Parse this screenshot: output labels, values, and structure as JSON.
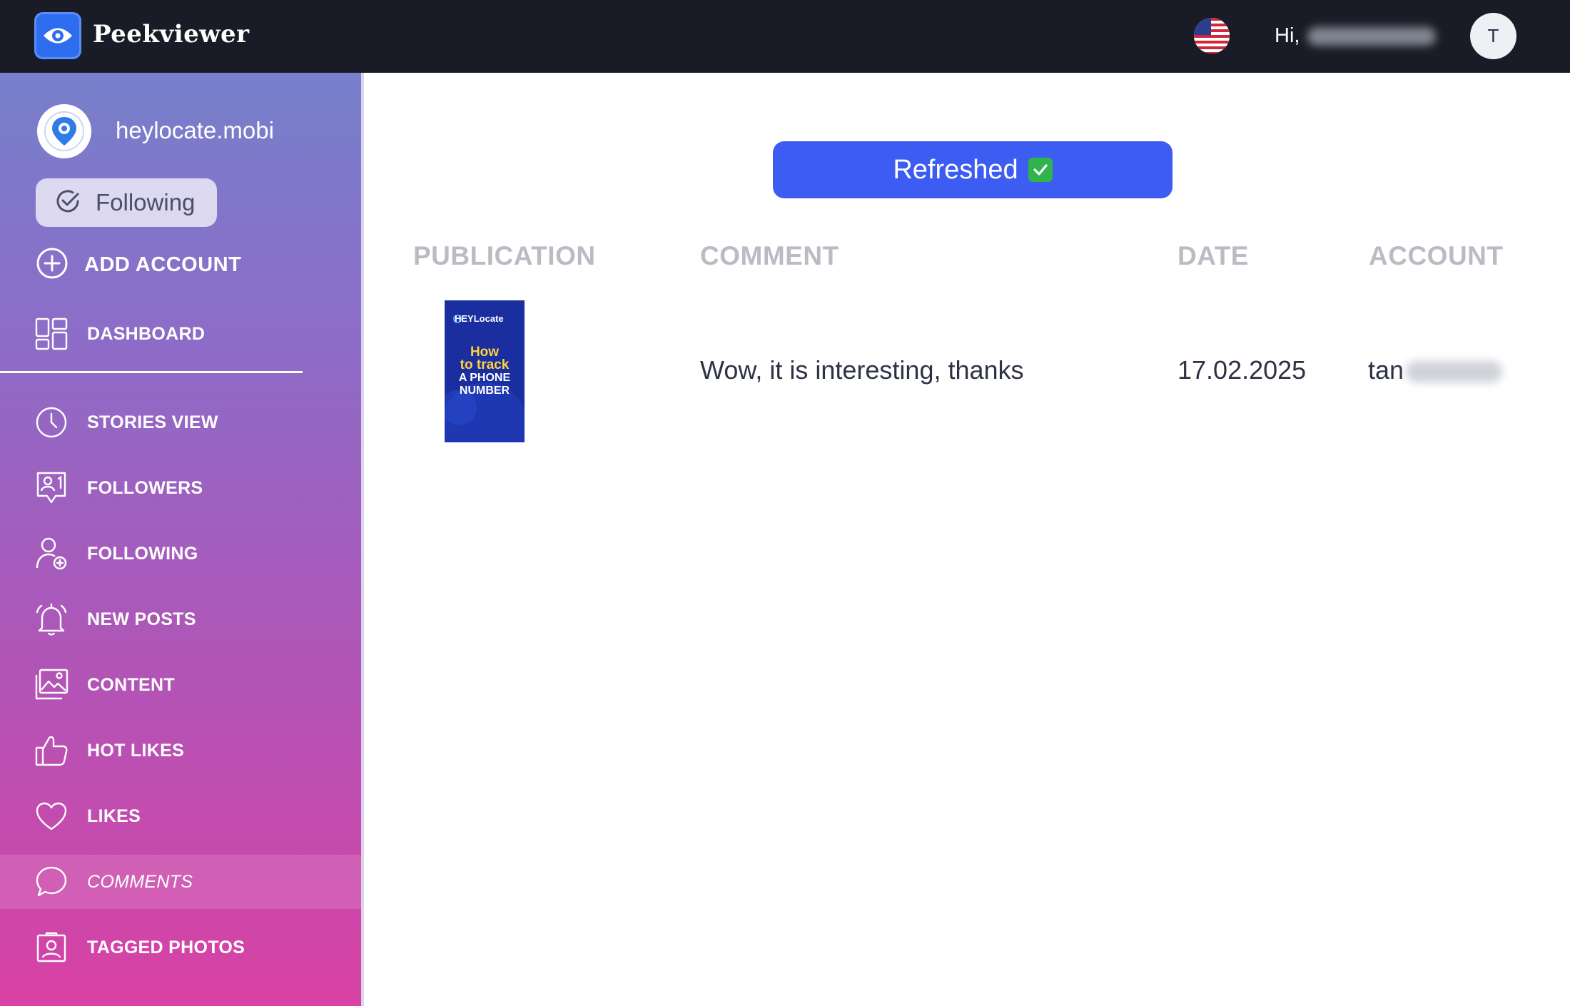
{
  "app": {
    "brand": "Peekviewer",
    "greeting": "Hi,",
    "avatar_initial": "T",
    "accent_color": "#3d5cf2",
    "topbar_color": "#191c27"
  },
  "sidebar": {
    "account_name": "heylocate.mobi",
    "follow_label": "Following",
    "add_account_label": "ADD ACCOUNT",
    "items": [
      {
        "label": "DASHBOARD",
        "icon": "dashboard-icon"
      },
      {
        "label": "STORIES VIEW",
        "icon": "clock-icon"
      },
      {
        "label": "FOLLOWERS",
        "icon": "followers-icon"
      },
      {
        "label": "FOLLOWING",
        "icon": "user-plus-icon"
      },
      {
        "label": "NEW POSTS",
        "icon": "bell-icon"
      },
      {
        "label": "CONTENT",
        "icon": "image-icon"
      },
      {
        "label": "HOT LIKES",
        "icon": "thumbs-up-icon"
      },
      {
        "label": "LIKES",
        "icon": "heart-icon"
      },
      {
        "label": "COMMENTS",
        "icon": "comment-icon",
        "active": true
      },
      {
        "label": "TAGGED PHOTOS",
        "icon": "tagged-photo-icon"
      }
    ]
  },
  "main": {
    "refresh_label": "Refreshed",
    "columns": [
      "PUBLICATION",
      "COMMENT",
      "DATE",
      "ACCOUNT"
    ],
    "rows": [
      {
        "thumbnail": {
          "brand": "HEYLocate",
          "line1": "How",
          "line2": "to track",
          "line3": "A PHONE",
          "line4": "NUMBER"
        },
        "comment": "Wow, it is interesting, thanks",
        "date": "17.02.2025",
        "account_visible": "tan"
      }
    ]
  }
}
